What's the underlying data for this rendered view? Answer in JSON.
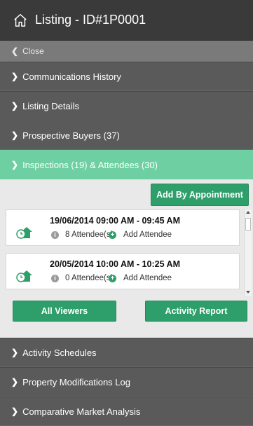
{
  "header": {
    "title": "Listing - ID#1P0001",
    "icon": "home-outline-icon"
  },
  "close_label": "Close",
  "sections_top": [
    {
      "label": "Communications History"
    },
    {
      "label": "Listing Details"
    },
    {
      "label": "Prospective Buyers (37)"
    }
  ],
  "active_section": {
    "label": "Inspections (19) & Attendees (30)"
  },
  "panel": {
    "add_button": "Add By Appointment",
    "inspections": [
      {
        "when": "19/06/2014 09:00 AM - 09:45 AM",
        "attendees": "8 Attendee(s)",
        "add": "Add Attendee"
      },
      {
        "when": "20/05/2014 10:00 AM - 10:25 AM",
        "attendees": "0 Attendee(s)",
        "add": "Add Attendee"
      }
    ],
    "all_viewers": "All Viewers",
    "activity_report": "Activity Report"
  },
  "sections_bottom": [
    {
      "label": "Activity Schedules"
    },
    {
      "label": "Property Modifications Log"
    },
    {
      "label": "Comparative Market Analysis"
    }
  ],
  "colors": {
    "accent": "#6ed0a2",
    "button": "#2e9e6a",
    "dark": "#3a3a3a",
    "section": "#5a5a5a"
  }
}
